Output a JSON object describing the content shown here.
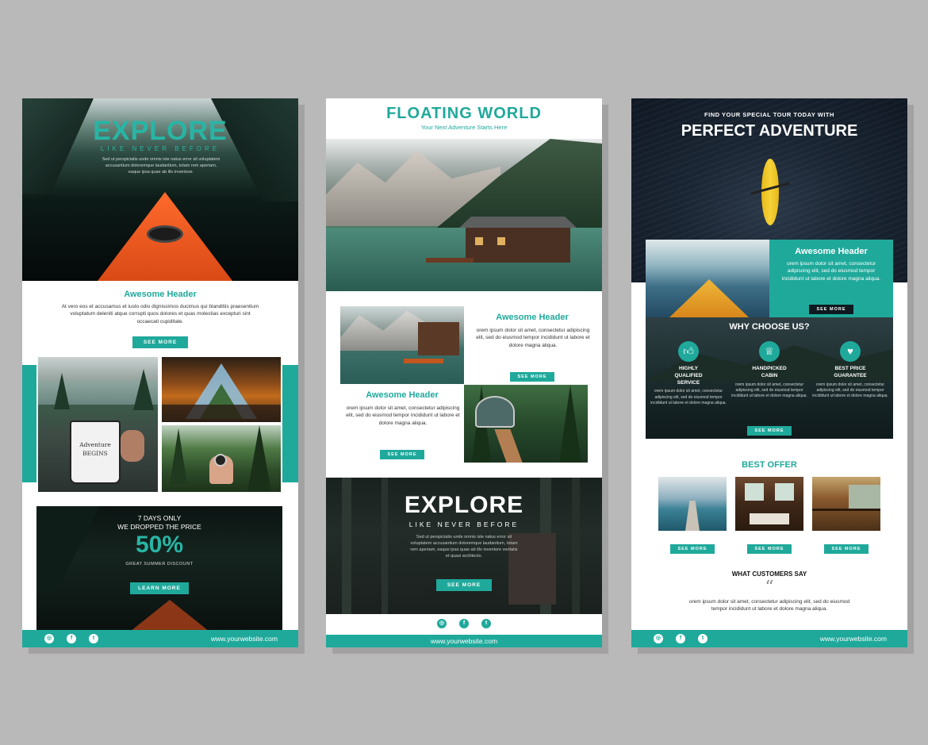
{
  "cards": {
    "left": {
      "hero_title": "EXPLORE",
      "hero_subtitle": "LIKE NEVER BEFORE",
      "hero_text": "Sed ut perspiciatis unde omnis iste natus error sit voluptatem accusantium doloremque laudantium, totam rem aperiam, eaque ipsa quae ab illo inventore.",
      "header": "Awesome Header",
      "body": "At vero eos et accusamus et iusto odio dignissimos ducimus qui blanditiis praesentium voluptatum deleniti atque corrupti quos dolores et quas molestias excepturi sint occaecati cupiditate.",
      "see_more": "SEE MORE",
      "mug_text": "Adventure BEGINS",
      "promo_line1": "7 DAYS ONLY",
      "promo_line2": "WE DROPPED THE PRICE",
      "promo_percent": "50%",
      "promo_caption": "GREAT SUMMER DISCOUNT",
      "learn_more": "LEARN MORE",
      "website": "www.yourwebsite.com"
    },
    "middle": {
      "title": "FLOATING WORLD",
      "subtitle": "Your Next Adventure Starts Here",
      "header1": "Awesome Header",
      "body1": "orem ipsum dolor sit amet, consectetur adipiscing elit, sed do eiusmod tempor incididunt ut labore et dolore magna aliqua.",
      "see_more1": "SEE MORE",
      "header2": "Awesome Header",
      "body2": "orem ipsum dolor sit amet, consectetur adipiscing elit, sed do eiusmod tempor incididunt ut labore et dolore magna aliqua.",
      "see_more2": "SEE MORE",
      "explore_title": "EXPLORE",
      "explore_subtitle": "LIKE NEVER BEFORE",
      "explore_text": "Sed ut perspiciatis unde omnis iste natus error sit voluptatem accusantium doloremque laudantium, totam rem aperiam, eaque ipsa quae ab illo inventore veritatis et quasi architecto.",
      "see_more3": "SEE MORE",
      "website": "www.yourwebsite.com"
    },
    "right": {
      "kicker": "FIND YOUR SPECIAL TOUR TODAY WITH",
      "title": "PERFECT ADVENTURE",
      "header": "Awesome Header",
      "body": "orem ipsum dolor sit amet, consectetur adipiscing elit, sed do eiusmod tempor incididunt ut labore et dolore magna aliqua.",
      "see_more": "SEE MORE",
      "why_title": "WHY CHOOSE US?",
      "features": [
        {
          "label": "HIGHLY QUALIFIED SERVICE",
          "text": "orem ipsum dolor sit amet, consectetur adipiscing elit, sed do eiusmod tempor incididunt ut labore et dolore magna aliqua."
        },
        {
          "label": "HANDPICKED CABIN",
          "text": "orem ipsum dolor sit amet, consectetur adipiscing elit, sed do eiusmod tempor incididunt ut labore et dolore magna aliqua."
        },
        {
          "label": "BEST PRICE GUARANTEE",
          "text": "orem ipsum dolor sit amet, consectetur adipiscing elit, sed do eiusmod tempor incididunt ut labore et dolore magna aliqua."
        }
      ],
      "see_more_why": "SEE MORE",
      "best_offer": "BEST OFFER",
      "offer_buttons": [
        "SEE MORE",
        "SEE MORE",
        "SEE MORE"
      ],
      "customers_title": "WHAT CUSTOMERS SAY",
      "quote_mark": "“",
      "testimonial": "orem ipsum dolor sit amet, consectetur adipiscing elit, sed do eiusmod tempor incididunt ut labore et dolore magna aliqua.",
      "website": "www.yourwebsite.com"
    }
  },
  "social_icons": [
    "instagram-icon",
    "facebook-icon",
    "twitter-icon"
  ],
  "colors": {
    "accent": "#1fa99b",
    "background": "#b9b9b9",
    "dark": "#0e1a20"
  }
}
